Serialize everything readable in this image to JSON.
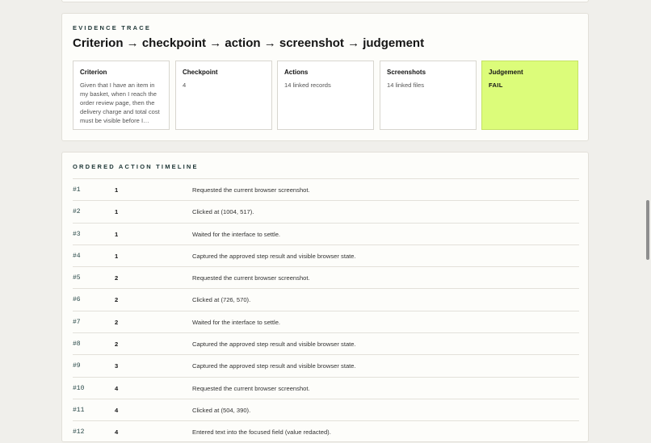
{
  "evidence": {
    "eyebrow": "EVIDENCE TRACE",
    "title": "Criterion → checkpoint → action → screenshot → judgement",
    "cards": [
      {
        "title": "Criterion",
        "body": "Given that I have an item in my basket, when I reach the order review page, then the delivery charge and total cost must be visible before I…"
      },
      {
        "title": "Checkpoint",
        "body": "4"
      },
      {
        "title": "Actions",
        "body": "14 linked records"
      },
      {
        "title": "Screenshots",
        "body": "14 linked files"
      },
      {
        "title": "Judgement",
        "body": "FAIL"
      }
    ]
  },
  "timeline": {
    "eyebrow": "ORDERED ACTION TIMELINE",
    "rows": [
      {
        "idx": "#1",
        "step": "1",
        "desc": "Requested the current browser screenshot."
      },
      {
        "idx": "#2",
        "step": "1",
        "desc": "Clicked at (1004, 517)."
      },
      {
        "idx": "#3",
        "step": "1",
        "desc": "Waited for the interface to settle."
      },
      {
        "idx": "#4",
        "step": "1",
        "desc": "Captured the approved step result and visible browser state."
      },
      {
        "idx": "#5",
        "step": "2",
        "desc": "Requested the current browser screenshot."
      },
      {
        "idx": "#6",
        "step": "2",
        "desc": "Clicked at (726, 570)."
      },
      {
        "idx": "#7",
        "step": "2",
        "desc": "Waited for the interface to settle."
      },
      {
        "idx": "#8",
        "step": "2",
        "desc": "Captured the approved step result and visible browser state."
      },
      {
        "idx": "#9",
        "step": "3",
        "desc": "Captured the approved step result and visible browser state."
      },
      {
        "idx": "#10",
        "step": "4",
        "desc": "Requested the current browser screenshot."
      },
      {
        "idx": "#11",
        "step": "4",
        "desc": "Clicked at (504, 390)."
      },
      {
        "idx": "#12",
        "step": "4",
        "desc": "Entered text into the focused field (value redacted)."
      }
    ]
  },
  "colors": {
    "judgement_fail_bg": "#dcfc7a",
    "eyebrow": "#203838"
  }
}
